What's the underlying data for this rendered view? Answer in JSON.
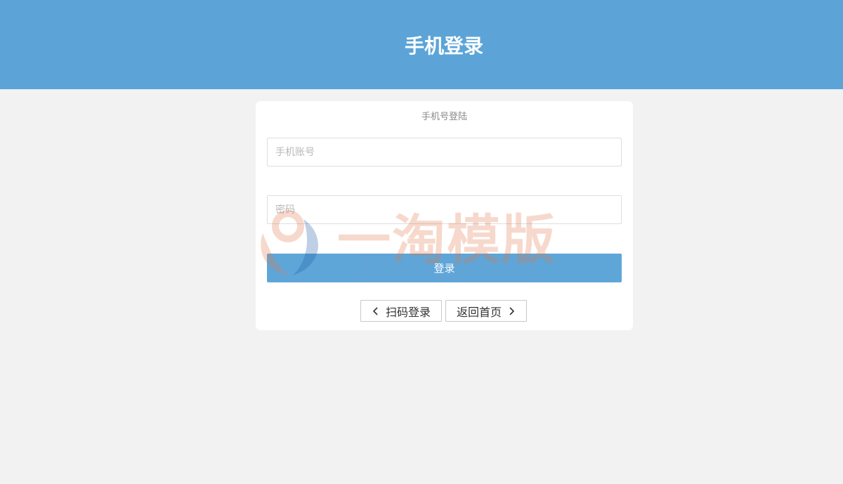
{
  "header": {
    "title": "手机登录"
  },
  "login": {
    "subtitle": "手机号登陆",
    "phone_placeholder": "手机账号",
    "password_placeholder": "密码",
    "submit_label": "登录",
    "scan_label": "扫码登录",
    "home_label": "返回首页"
  },
  "watermark": {
    "text": "一淘模版"
  },
  "colors": {
    "header": "#5ca4d7",
    "button": "#5ca4d7",
    "background": "#f2f2f2"
  }
}
